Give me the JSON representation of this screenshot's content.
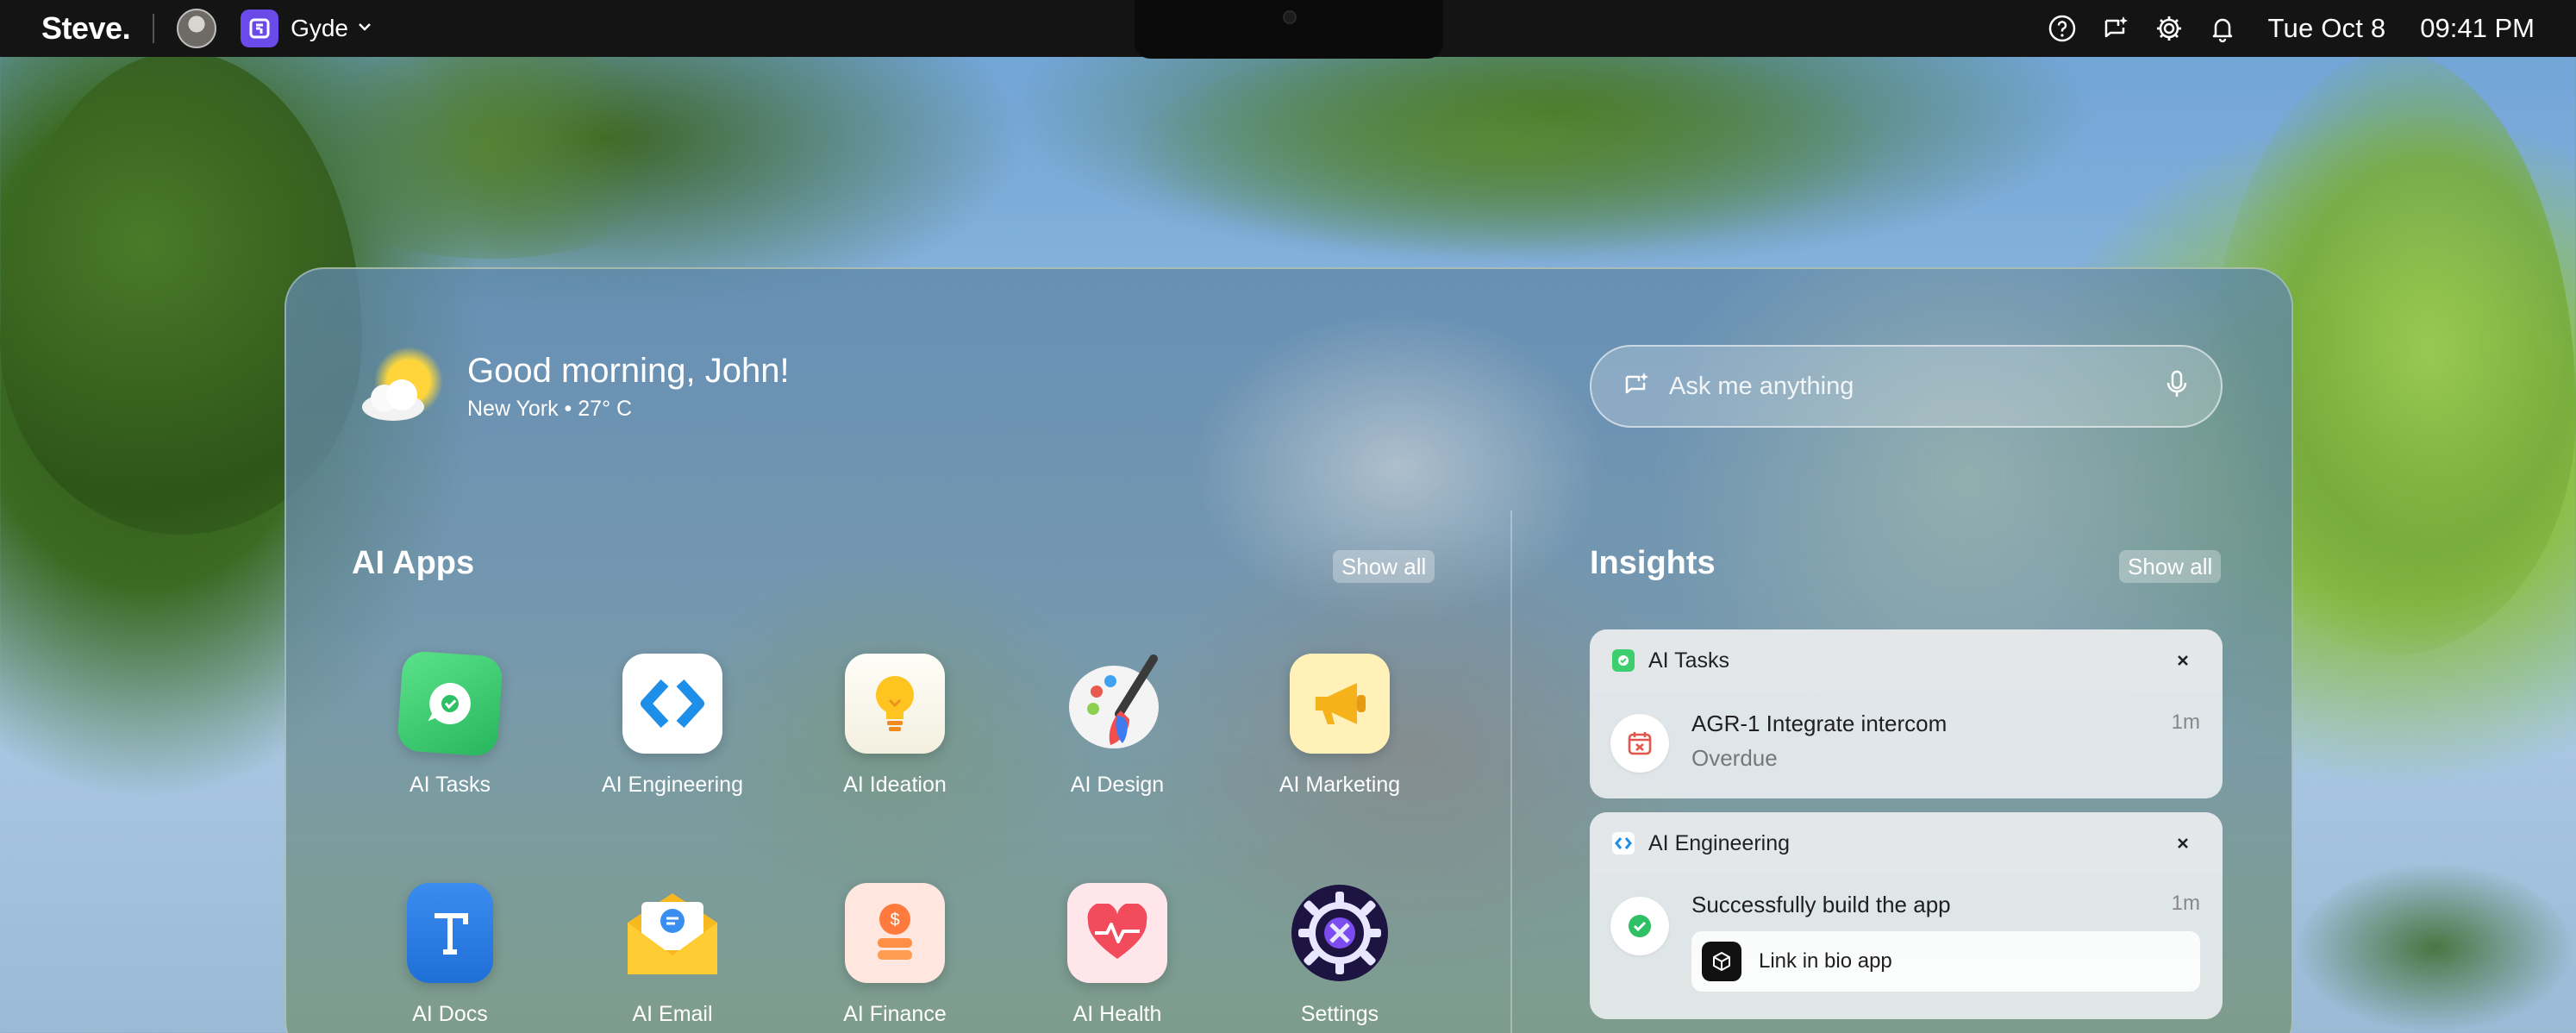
{
  "menubar": {
    "brand": "Steve.",
    "workspace_name": "Gyde",
    "date": "Tue Oct 8",
    "time": "09:41 PM",
    "icons": [
      "help-icon",
      "ai-assistant-icon",
      "gear-icon",
      "bell-icon"
    ]
  },
  "greeting": {
    "title": "Good morning, John!",
    "subtitle": "New York • 27° C",
    "icon": "partly-cloudy-icon"
  },
  "search": {
    "placeholder": "Ask me anything",
    "value": ""
  },
  "ai_apps": {
    "title": "AI Apps",
    "show_all_label": "Show all",
    "apps": [
      {
        "label": "AI Tasks",
        "icon": "tasks-check-icon"
      },
      {
        "label": "AI Engineering",
        "icon": "code-brackets-icon"
      },
      {
        "label": "AI Ideation",
        "icon": "lightbulb-icon"
      },
      {
        "label": "AI Design",
        "icon": "palette-brush-icon"
      },
      {
        "label": "AI Marketing",
        "icon": "megaphone-icon"
      },
      {
        "label": "AI Docs",
        "icon": "text-document-icon"
      },
      {
        "label": "AI Email",
        "icon": "envelope-icon"
      },
      {
        "label": "AI Finance",
        "icon": "coins-icon"
      },
      {
        "label": "AI Health",
        "icon": "heart-pulse-icon"
      },
      {
        "label": "Settings",
        "icon": "gear-icon"
      }
    ]
  },
  "insights": {
    "title": "Insights",
    "show_all_label": "Show all",
    "cards": [
      {
        "app": "AI Tasks",
        "item_title": "AGR-1 Integrate intercom",
        "item_subtitle": "Overdue",
        "time": "1m"
      },
      {
        "app": "AI Engineering",
        "item_title": "Successfully build the app",
        "time": "1m",
        "link_label": "Link in bio app"
      }
    ]
  },
  "colors": {
    "menubar": "#141414",
    "workspace_accent": "#6a4ae8",
    "tasks_green": "#3dcf6d",
    "engineering_blue": "#1e8fe8",
    "overdue_red": "#e3554d"
  }
}
